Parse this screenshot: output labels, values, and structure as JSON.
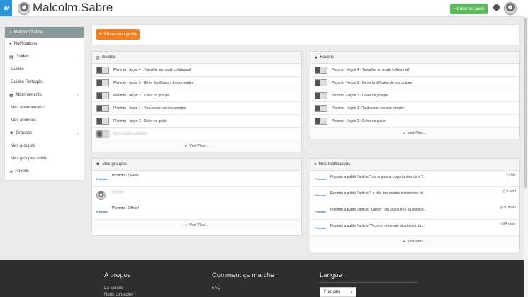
{
  "header": {
    "logo_text": "W",
    "username": "Malcolm.Sabre",
    "create_guide_label": "Créer un guide",
    "create_guide_color": "#5cb85c"
  },
  "sidebar": {
    "head": "Malcolm.Sabre",
    "items": [
      {
        "label": "Notifications",
        "icon": "globe-icon"
      },
      {
        "label": "Guides",
        "icon": "book-icon"
      },
      {
        "label": "Guides",
        "sub": true
      },
      {
        "label": "Guides Partagés",
        "sub": true
      },
      {
        "label": "Abonnements",
        "icon": "bookmark-icon"
      },
      {
        "label": "Mes abonnements",
        "sub": true
      },
      {
        "label": "Mes abonnés",
        "sub": true
      },
      {
        "label": "Groupes",
        "icon": "users-icon"
      },
      {
        "label": "Mes groupes",
        "sub": true
      },
      {
        "label": "Mes groupes suivis",
        "sub": true
      },
      {
        "label": "Favoris",
        "icon": "star-icon"
      }
    ]
  },
  "edit_profile_label": "Editer mon profile",
  "accent_color": "#f0801f",
  "guides": {
    "title": "Guides",
    "rows": [
      "Picomto - leçon 4 : Travailler en mode collaboratif",
      "Picomto - leçon 5 : Gérer la diffusion de vos guides",
      "Picomto - leçon 3 : Créer un groupe",
      "Picomto - leçon 1 : Tout savoir sur son compte",
      "Picomto - leçon 2 : Créer un guide",
      "Mon modèle prédéfini"
    ],
    "more": "Voir Plus..."
  },
  "favoris": {
    "title": "Favoris",
    "rows": [
      "Picomto - leçon 4 : Travailler en mode collaboratif",
      "Picomto - leçon 5 : Gérer la diffusion de vos guides",
      "Picomto - leçon 3 : Créer un groupe",
      "Picomto - leçon 1 : Tout savoir sur son compte",
      "Picomto - leçon 2 : Créer un guide"
    ],
    "more": "Voir Plus..."
  },
  "groupes": {
    "title": "Mes groupes",
    "rows": [
      "Picomto - DEMO",
      "Groupe",
      "Picomto - Officiel"
    ],
    "brand": "Picomto",
    "more": "Voir Plus..."
  },
  "notifications": {
    "title": "Mes notifications",
    "rows": [
      {
        "text": "Picomto a publié l'article \"Les enjeux et opportunités du « T...",
        "time": "Hier"
      },
      {
        "text": "Picomto a publié l'article \"Le rôle des modes opératoires da...",
        "time": "6 avril"
      },
      {
        "text": "Picomto a publié l'article \"Kaizen : Un savoir être au service...",
        "time": "30 mars"
      },
      {
        "text": "Picomto a publié l'article \"Picomto réinvente la création, la ...",
        "time": "24 mars"
      }
    ],
    "brand": "Picomto",
    "more": "Voir Plus..."
  },
  "footer": {
    "about_title": "A propos",
    "about_links": [
      "La société",
      "Nous contacter"
    ],
    "how_title": "Comment ça marche",
    "how_links": [
      "FAQ"
    ],
    "lang_title": "Langue",
    "lang_value": "Français"
  }
}
